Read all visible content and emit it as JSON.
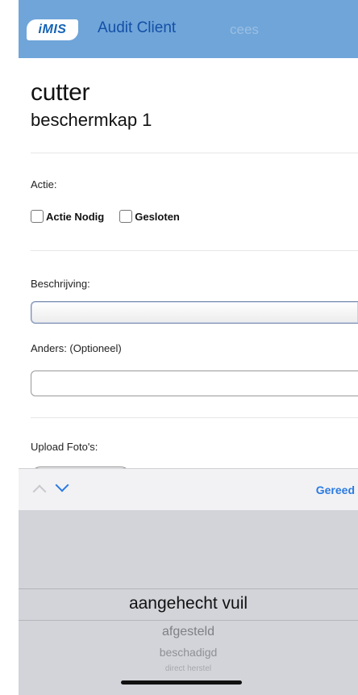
{
  "navbar": {
    "logo_text": "iMIS",
    "title": "Audit Client",
    "user": "cees"
  },
  "header": {
    "title": "cutter",
    "subtitle": "beschermkap 1"
  },
  "form": {
    "actie_label": "Actie:",
    "checkboxes": [
      {
        "label": "Actie Nodig",
        "checked": false
      },
      {
        "label": "Gesloten",
        "checked": false
      }
    ],
    "beschrijving_label": "Beschrijving:",
    "beschrijving_value": "",
    "anders_label": "Anders: (Optioneel)",
    "anders_value": "",
    "upload_label": "Upload Foto's:"
  },
  "picker": {
    "done_label": "Gereed",
    "options": [
      "aangehecht vuil",
      "afgesteld",
      "beschadigd",
      "direct herstel"
    ],
    "selected_index": 0
  },
  "colors": {
    "navbar_bg": "#6fa5d9",
    "nav_title": "#1450a6",
    "accent": "#2a7ae2"
  },
  "icons": [
    "chevron-up-icon",
    "chevron-down-icon"
  ]
}
